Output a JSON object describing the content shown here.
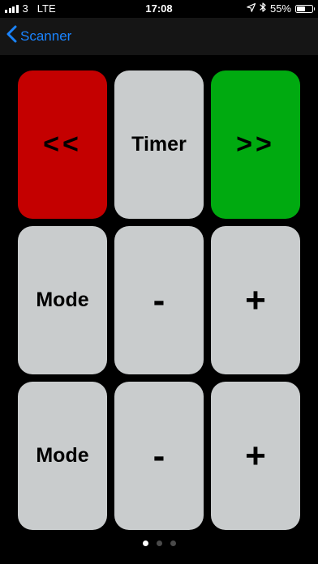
{
  "status_bar": {
    "carrier": "3",
    "network": "LTE",
    "time": "17:08",
    "battery_percent": "55%",
    "battery_level": 0.55
  },
  "nav": {
    "back_label": "Scanner",
    "accent_color": "#1a84ff"
  },
  "pads": [
    {
      "label": "<<",
      "color": "#c40000"
    },
    {
      "label": "Timer",
      "color": "#c9cccd"
    },
    {
      "label": ">>",
      "color": "#00aa10"
    },
    {
      "label": "Mode",
      "color": "#c9cccd"
    },
    {
      "label": "-",
      "color": "#c9cccd"
    },
    {
      "label": "+",
      "color": "#c9cccd"
    },
    {
      "label": "Mode",
      "color": "#c9cccd"
    },
    {
      "label": "-",
      "color": "#c9cccd"
    },
    {
      "label": "+",
      "color": "#c9cccd"
    }
  ],
  "page_indicator": {
    "pages": 3,
    "current": 1
  }
}
